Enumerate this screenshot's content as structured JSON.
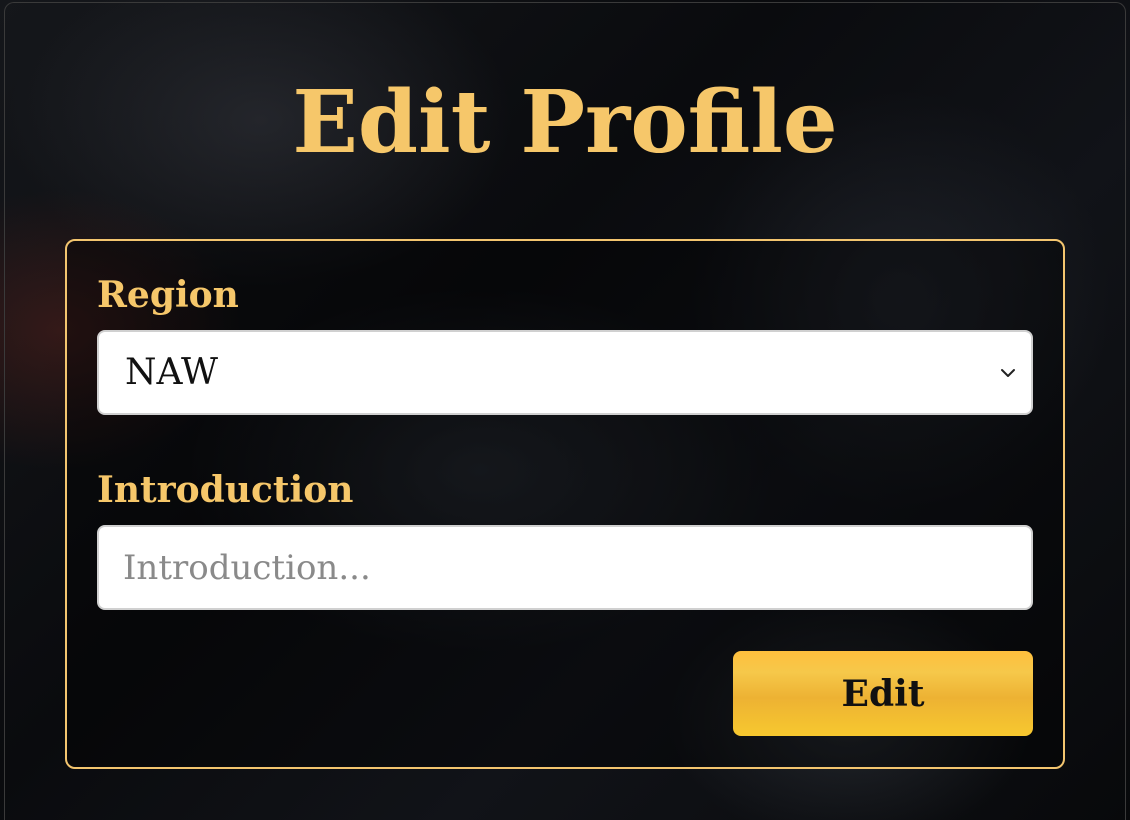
{
  "page": {
    "title": "Edit Profile"
  },
  "form": {
    "region": {
      "label": "Region",
      "selected": "NAW"
    },
    "introduction": {
      "label": "Introduction",
      "value": "",
      "placeholder": "Introduction..."
    },
    "submit_label": "Edit"
  },
  "colors": {
    "accent": "#f6c76a",
    "button": "#f2bd3a",
    "background": "#0b0c0f"
  },
  "icons": {
    "region_dropdown": "chevron-down-icon"
  }
}
